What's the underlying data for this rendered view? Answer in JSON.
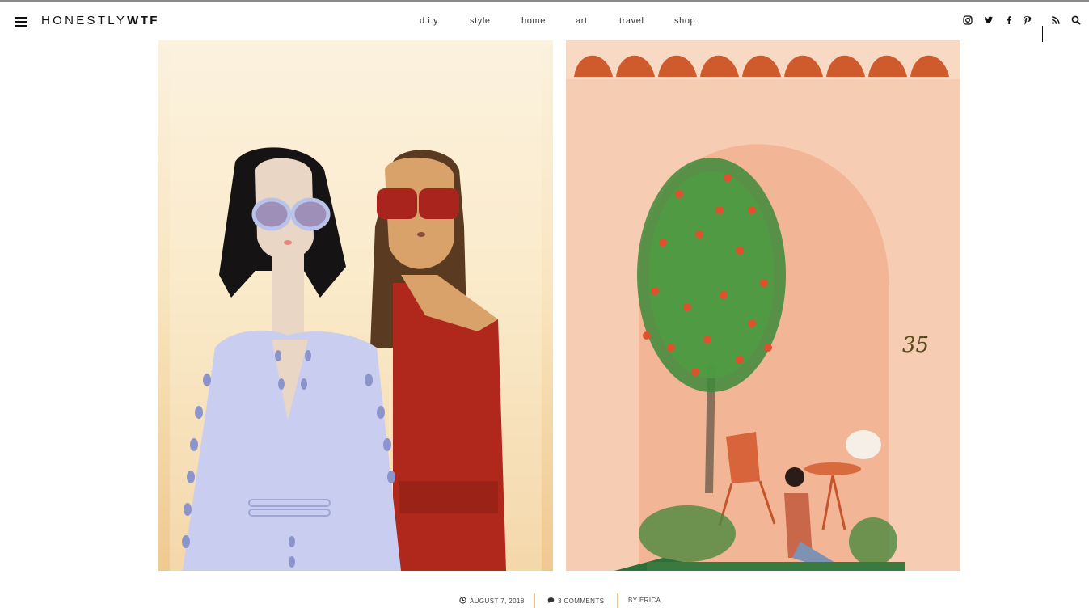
{
  "site": {
    "logo_light": "HONESTLY",
    "logo_bold": "WTF"
  },
  "nav": {
    "items": [
      {
        "label": "d.i.y."
      },
      {
        "label": "style"
      },
      {
        "label": "home"
      },
      {
        "label": "art"
      },
      {
        "label": "travel"
      },
      {
        "label": "shop"
      }
    ]
  },
  "header_icons": [
    "menu-icon",
    "instagram-icon",
    "twitter-icon",
    "facebook-icon",
    "pinterest-icon",
    "rss-icon",
    "search-icon"
  ],
  "artwork": {
    "right_number": "35"
  },
  "post_meta": {
    "date": "AUGUST 7, 2018",
    "comments": "3 COMMENTS",
    "author": "BY ERICA"
  },
  "colors": {
    "accent_divider": "#e8c58a",
    "left_bg": "#f7e3b6",
    "right_bg": "#f6cdb2"
  }
}
